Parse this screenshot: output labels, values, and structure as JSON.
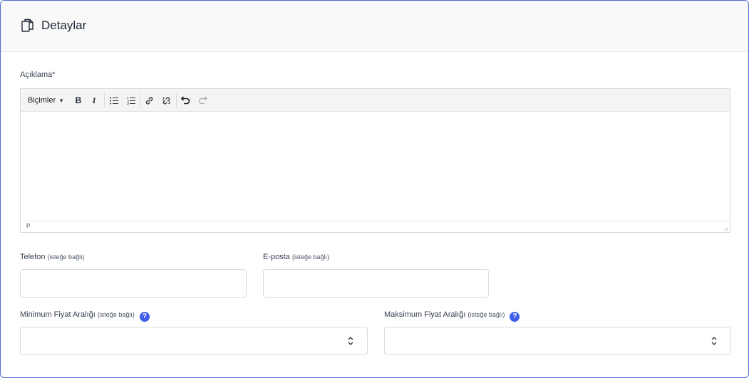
{
  "header": {
    "title": "Detaylar",
    "icon": "copy-icon"
  },
  "description": {
    "label": "Açıklama",
    "required_mark": "*",
    "toolbar": {
      "formats_label": "Biçimler",
      "bold": "B",
      "italic": "I",
      "buttons": [
        "bold-icon",
        "italic-icon",
        "bullet-list-icon",
        "numbered-list-icon",
        "link-icon",
        "unlink-icon",
        "undo-icon",
        "redo-icon"
      ]
    },
    "value": "",
    "path": "P"
  },
  "phone": {
    "label": "Telefon",
    "optional": "(isteğe bağlı)",
    "value": ""
  },
  "email": {
    "label": "E-posta",
    "optional": "(isteğe bağlı)",
    "value": ""
  },
  "min_price": {
    "label": "Minimum Fiyat Aralığı",
    "optional": "(isteğe bağlı)",
    "help": "?",
    "value": ""
  },
  "max_price": {
    "label": "Maksimum Fiyat Aralığı",
    "optional": "(isteğe bağlı)",
    "help": "?",
    "value": ""
  },
  "colors": {
    "border_accent": "#4f6bd8",
    "help_badge": "#3f5ee8"
  }
}
